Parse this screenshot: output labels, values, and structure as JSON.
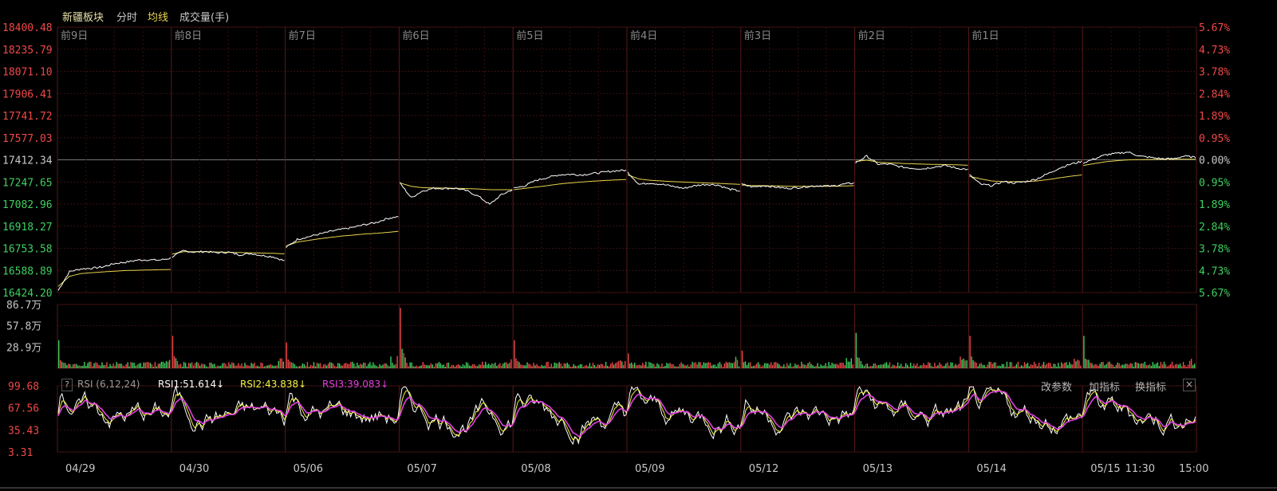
{
  "header": {
    "title": "新疆板块",
    "tab_fenshi": "分时",
    "tab_junxian": "均线",
    "tab_volume": "成交量(手)"
  },
  "colors": {
    "price_line": "#ffffff",
    "avg_line": "#e8d44d",
    "up": "#f04848",
    "down": "#3fcf5f",
    "rsi1": "#ffffff",
    "rsi2": "#f5f542",
    "rsi3": "#e040e0",
    "grid": "#3a0f0f"
  },
  "chart_data": [
    {
      "type": "line",
      "panel": "price",
      "y_ticks": [
        "18400.48",
        "18235.79",
        "18071.10",
        "17906.41",
        "17741.72",
        "17577.03",
        "17412.34",
        "17247.65",
        "17082.96",
        "16918.27",
        "16753.58",
        "16588.89",
        "16424.20"
      ],
      "pct_ticks": [
        "5.67%",
        "4.73%",
        "3.78%",
        "2.84%",
        "1.89%",
        "0.95%",
        "0.00%",
        "0.95%",
        "1.89%",
        "2.84%",
        "3.78%",
        "4.73%",
        "5.67%"
      ],
      "ylim": [
        16424.2,
        18400.48
      ],
      "reference": 17412.34,
      "day_labels": [
        "前9日",
        "前8日",
        "前7日",
        "前6日",
        "前5日",
        "前4日",
        "前3日",
        "前2日",
        "前1日",
        ""
      ],
      "days": [
        {
          "price": [
            16440,
            16580,
            16600,
            16605,
            16615,
            16640,
            16650,
            16665,
            16668,
            16665,
            16680
          ],
          "avg": [
            16470,
            16545,
            16565,
            16572,
            16578,
            16583,
            16588,
            16590,
            16592,
            16594,
            16596
          ]
        },
        {
          "price": [
            16690,
            16735,
            16725,
            16730,
            16720,
            16725,
            16705,
            16715,
            16700,
            16690,
            16660
          ],
          "avg": [
            16710,
            16728,
            16728,
            16728,
            16726,
            16724,
            16722,
            16720,
            16718,
            16716,
            16712
          ]
        },
        {
          "price": [
            16760,
            16820,
            16840,
            16860,
            16880,
            16895,
            16910,
            16930,
            16945,
            16975,
            16990
          ],
          "avg": [
            16770,
            16800,
            16812,
            16825,
            16835,
            16845,
            16852,
            16860,
            16865,
            16872,
            16880
          ]
        },
        {
          "price": [
            17240,
            17130,
            17180,
            17200,
            17200,
            17200,
            17180,
            17140,
            17080,
            17150,
            17190
          ],
          "avg": [
            17240,
            17215,
            17205,
            17203,
            17202,
            17200,
            17198,
            17195,
            17190,
            17190,
            17190
          ]
        },
        {
          "price": [
            17200,
            17220,
            17260,
            17280,
            17300,
            17305,
            17300,
            17310,
            17320,
            17330,
            17335
          ],
          "avg": [
            17190,
            17200,
            17210,
            17220,
            17232,
            17240,
            17247,
            17253,
            17258,
            17262,
            17266
          ]
        },
        {
          "price": [
            17320,
            17230,
            17240,
            17230,
            17215,
            17200,
            17220,
            17230,
            17225,
            17195,
            17180
          ],
          "avg": [
            17300,
            17270,
            17260,
            17255,
            17250,
            17247,
            17243,
            17240,
            17237,
            17233,
            17230
          ]
        },
        {
          "price": [
            17230,
            17210,
            17220,
            17210,
            17200,
            17205,
            17215,
            17220,
            17215,
            17230,
            17240
          ],
          "avg": [
            17225,
            17220,
            17220,
            17218,
            17216,
            17215,
            17215,
            17215,
            17216,
            17217,
            17220
          ]
        },
        {
          "price": [
            17390,
            17440,
            17380,
            17380,
            17360,
            17350,
            17345,
            17360,
            17370,
            17350,
            17340
          ],
          "avg": [
            17400,
            17410,
            17395,
            17390,
            17386,
            17383,
            17380,
            17378,
            17377,
            17375,
            17372
          ]
        },
        {
          "price": [
            17300,
            17230,
            17220,
            17250,
            17240,
            17250,
            17270,
            17310,
            17350,
            17380,
            17400
          ],
          "avg": [
            17290,
            17270,
            17255,
            17250,
            17250,
            17250,
            17255,
            17265,
            17278,
            17290,
            17300
          ]
        },
        {
          "price": [
            17390,
            17420,
            17450,
            17460,
            17470,
            17440,
            17430,
            17420,
            17420,
            17440,
            17430
          ],
          "avg": [
            17370,
            17385,
            17398,
            17406,
            17412,
            17414,
            17415,
            17416,
            17416,
            17417,
            17417
          ]
        }
      ]
    },
    {
      "type": "bar",
      "panel": "volume",
      "y_ticks": [
        "86.7万",
        "57.8万",
        "28.9万"
      ],
      "ylim": [
        0,
        86.7
      ],
      "day_open_spikes": [
        38,
        44,
        35,
        82,
        38,
        20,
        24,
        48,
        44,
        44
      ]
    },
    {
      "type": "line",
      "panel": "rsi",
      "indicator": "RSI (6,12,24)",
      "y_ticks": [
        "99.68",
        "67.56",
        "35.43",
        "3.31"
      ],
      "ylim": [
        3.31,
        99.68
      ],
      "x_labels": [
        "04/29",
        "04/30",
        "05/06",
        "05/07",
        "05/08",
        "05/09",
        "05/12",
        "05/13",
        "05/14",
        "05/15",
        "11:30",
        "15:00"
      ]
    }
  ],
  "rsi_panel": {
    "help": "?",
    "name": "RSI (6,12,24)",
    "rsi1": "RSI1:51.614↓",
    "rsi2": "RSI2:43.838↓",
    "rsi3": "RSI3:39.083↓",
    "btn_params": "改参数",
    "btn_add": "加指标",
    "btn_switch": "换指标",
    "btn_close": "×"
  }
}
